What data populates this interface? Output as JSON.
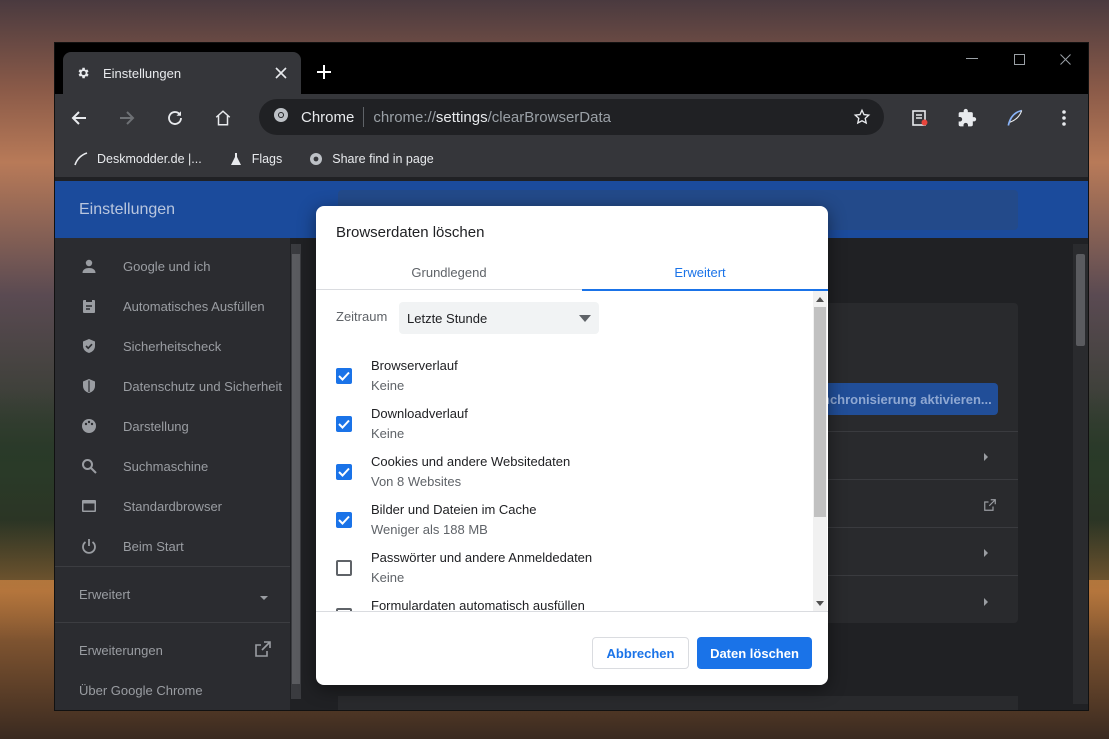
{
  "tab": {
    "title": "Einstellungen",
    "icon": "gear-icon"
  },
  "omnibox": {
    "site": "Chrome",
    "url_prefix": "chrome://",
    "url_host": "settings",
    "url_path": "/clearBrowserData"
  },
  "bookmarks": [
    {
      "label": "Deskmodder.de |...",
      "icon": "feather-icon"
    },
    {
      "label": "Flags",
      "icon": "flask-icon"
    },
    {
      "label": "Share find in page",
      "icon": "chromium-icon"
    }
  ],
  "settings": {
    "header_title": "Einstellungen",
    "sidebar": [
      {
        "label": "Google und ich",
        "icon": "person-icon"
      },
      {
        "label": "Automatisches Ausfüllen",
        "icon": "clipboard-icon"
      },
      {
        "label": "Sicherheitscheck",
        "icon": "shield-check-icon"
      },
      {
        "label": "Datenschutz und Sicherheit",
        "icon": "shield-icon"
      },
      {
        "label": "Darstellung",
        "icon": "palette-icon"
      },
      {
        "label": "Suchmaschine",
        "icon": "search-icon"
      },
      {
        "label": "Standardbrowser",
        "icon": "browser-icon"
      },
      {
        "label": "Beim Start",
        "icon": "power-icon"
      }
    ],
    "advanced_label": "Erweitert",
    "extensions_label": "Erweiterungen",
    "about_label": "Über Google Chrome",
    "sync_button": "nchronisierung aktivieren..."
  },
  "dialog": {
    "title": "Browserdaten löschen",
    "tabs": [
      {
        "label": "Grundlegend",
        "active": false
      },
      {
        "label": "Erweitert",
        "active": true
      }
    ],
    "range_label": "Zeitraum",
    "range_value": "Letzte Stunde",
    "options": [
      {
        "label": "Browserverlauf",
        "sub": "Keine",
        "checked": true
      },
      {
        "label": "Downloadverlauf",
        "sub": "Keine",
        "checked": true
      },
      {
        "label": "Cookies und andere Websitedaten",
        "sub": "Von 8 Websites",
        "checked": true
      },
      {
        "label": "Bilder und Dateien im Cache",
        "sub": "Weniger als 188 MB",
        "checked": true
      },
      {
        "label": "Passwörter und andere Anmeldedaten",
        "sub": "Keine",
        "checked": false
      },
      {
        "label": "Formulardaten automatisch ausfüllen",
        "sub": "",
        "checked": false
      }
    ],
    "cancel_label": "Abbrechen",
    "confirm_label": "Daten löschen"
  },
  "colors": {
    "accent": "#1a73e8",
    "header": "#1b4b9c"
  }
}
